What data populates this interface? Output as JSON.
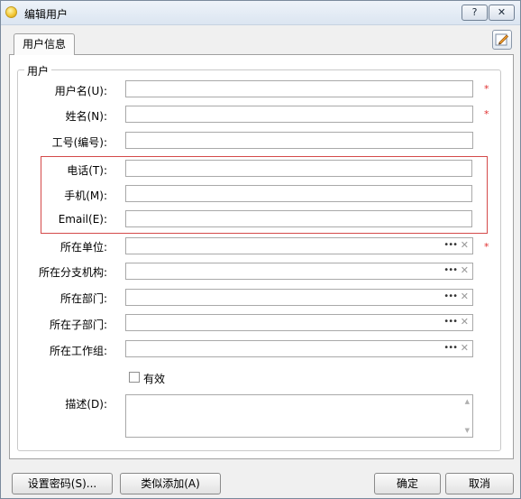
{
  "window": {
    "title": "编辑用户",
    "help_label": "?",
    "close_label": "✕"
  },
  "tabs": [
    {
      "label": "用户信息"
    }
  ],
  "group": {
    "title": "用户"
  },
  "fields": {
    "username": {
      "label": "用户名(U):",
      "value": "",
      "required": "*"
    },
    "name": {
      "label": "姓名(N):",
      "value": "",
      "required": "*"
    },
    "employee_no": {
      "label": "工号(编号):",
      "value": ""
    },
    "phone": {
      "label": "电话(T):",
      "value": ""
    },
    "mobile": {
      "label": "手机(M):",
      "value": ""
    },
    "email": {
      "label": "Email(E):",
      "value": ""
    },
    "unit": {
      "label": "所在单位:",
      "value": "",
      "required": "*"
    },
    "branch": {
      "label": "所在分支机构:",
      "value": ""
    },
    "department": {
      "label": "所在部门:",
      "value": ""
    },
    "sub_department": {
      "label": "所在子部门:",
      "value": ""
    },
    "work_group": {
      "label": "所在工作组:",
      "value": ""
    },
    "valid": {
      "label": "有效",
      "checked": false
    },
    "description": {
      "label": "描述(D):",
      "value": ""
    }
  },
  "lookup": {
    "browse": "•••",
    "clear": "✕"
  },
  "buttons": {
    "set_password": "设置密码(S)...",
    "similar_add": "类似添加(A)",
    "ok": "确定",
    "cancel": "取消"
  }
}
